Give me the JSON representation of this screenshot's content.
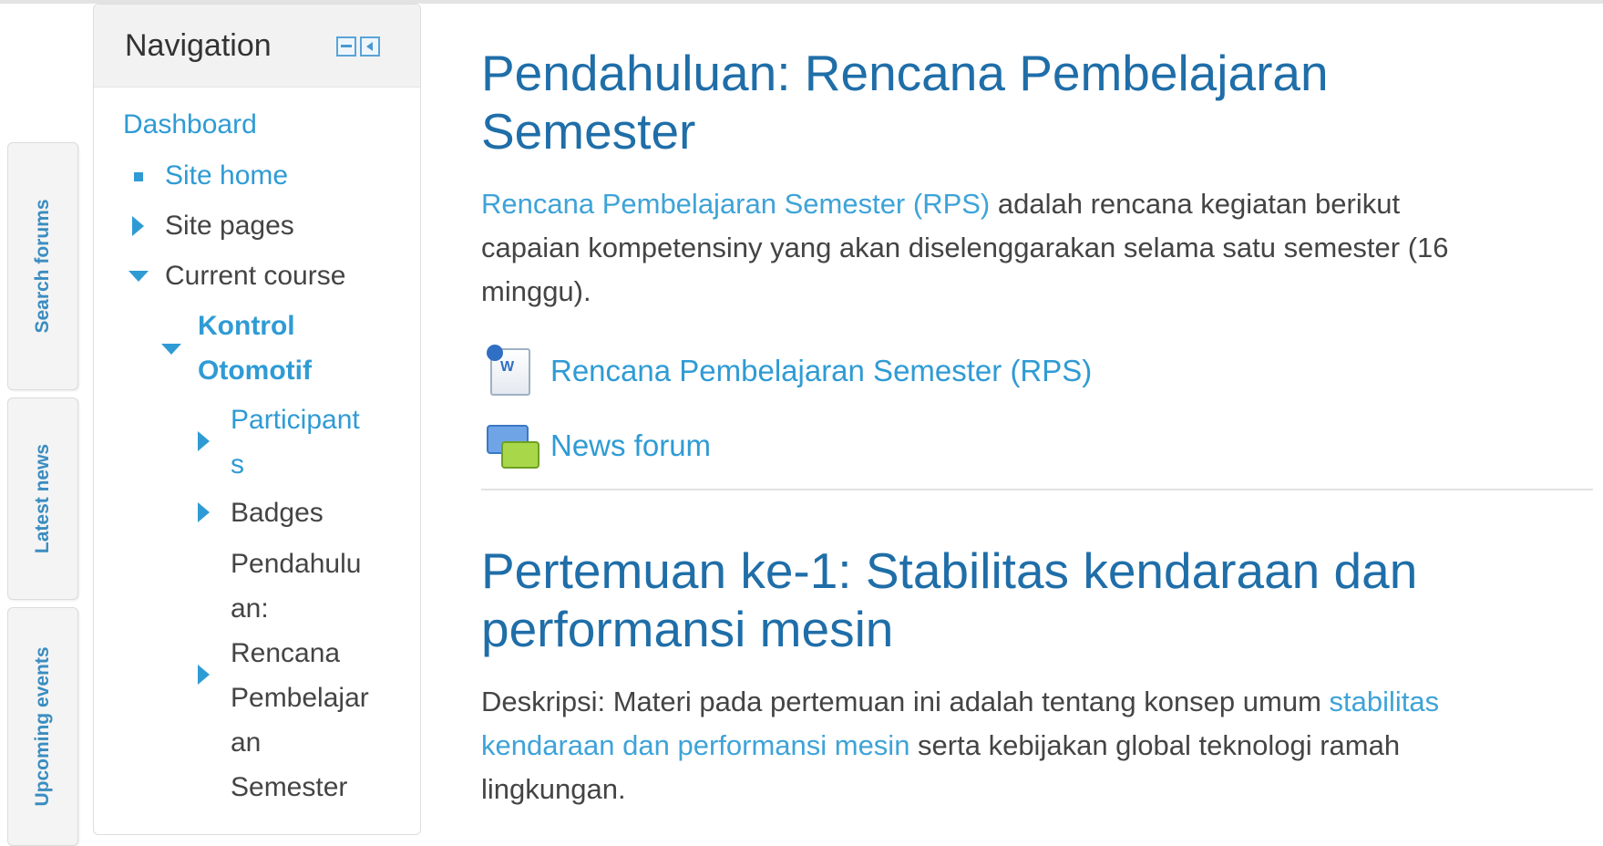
{
  "dock": {
    "tabs": [
      {
        "label": "Search forums"
      },
      {
        "label": "Latest news"
      },
      {
        "label": "Upcoming events"
      }
    ]
  },
  "navigation": {
    "title": "Navigation",
    "items": {
      "dashboard": "Dashboard",
      "site_home": "Site home",
      "site_pages": "Site pages",
      "current_course": "Current course",
      "course_name_1": "Kontrol",
      "course_name_2": "Otomotif",
      "participants_1": "Participant",
      "participants_2": "s",
      "badges": "Badges",
      "section_1": "Pendahulu",
      "section_2": "an:",
      "section_3": "Rencana",
      "section_4": "Pembelajar",
      "section_5": "an",
      "section_6": "Semester"
    }
  },
  "sections": [
    {
      "title_line1": "Pendahuluan: Rencana Pembelajaran",
      "title_line2": "Semester",
      "summary_link": "Rencana Pembelajaran Semester (RPS)",
      "summary_line1_rest": " adalah rencana kegiatan berikut",
      "summary_line2": "capaian kompetensiny yang akan diselenggarakan selama satu semester (16",
      "summary_line3": "minggu).",
      "activities": [
        {
          "label": "Rencana Pembelajaran Semester (RPS)",
          "icon": "word-document-icon"
        },
        {
          "label": "News forum",
          "icon": "forum-icon"
        }
      ]
    },
    {
      "title_line1": "Pertemuan ke-1: Stabilitas kendaraan dan",
      "title_line2": "performansi mesin",
      "summary_line1_text": "Deskripsi: Materi pada pertemuan ini adalah tentang konsep umum ",
      "summary_line1_link": "stabilitas",
      "summary_line2_link": "kendaraan dan performansi mesin",
      "summary_line2_rest": " serta kebijakan global teknologi ramah",
      "summary_line3": "lingkungan."
    }
  ]
}
